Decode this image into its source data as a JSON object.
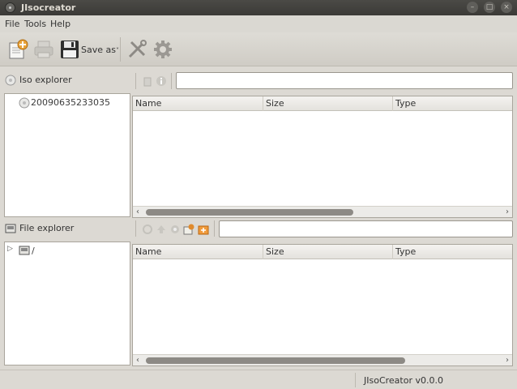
{
  "window": {
    "title": "JIsocreator"
  },
  "menu": {
    "file": "File",
    "tools": "Tools",
    "help": "Help"
  },
  "toolbar": {
    "save_as_label": "Save as"
  },
  "iso_explorer": {
    "title": "Iso explorer",
    "tree_root": "20090635233035",
    "search_value": "",
    "columns": [
      "Name",
      "Size",
      "Type"
    ]
  },
  "file_explorer": {
    "title": "File explorer",
    "tree_root": "/",
    "search_value": "",
    "columns": [
      "Name",
      "Size",
      "Type"
    ]
  },
  "status": {
    "version": "JIsoCreator v0.0.0"
  }
}
